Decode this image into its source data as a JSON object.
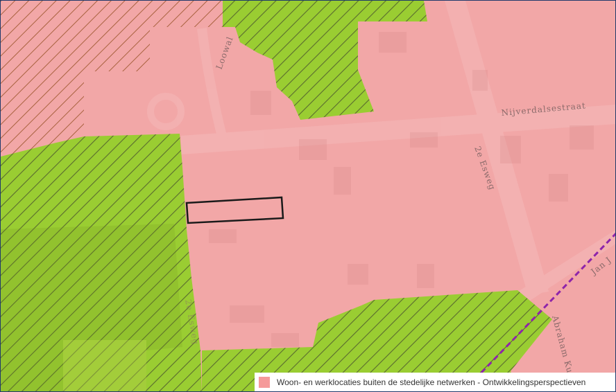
{
  "colors": {
    "zone_fill": "#f2a7a7",
    "green_fill": "#9acd32",
    "hatch_line": "#5a6b2f",
    "boundary": "#1a1a1a",
    "route": "#8e24aa",
    "legend_swatch": "#f59a9a"
  },
  "streets": {
    "nijverdalsestraat": "Nijverdalsestraat",
    "loowal": "Loowal",
    "tweede_esweg": "2e Esweg",
    "jan": "Jan J",
    "abraham_kuyper": "Abraham Kuyp",
    "esweg_left": "2e Esweg"
  },
  "legend": {
    "label": "Woon- en werklocaties buiten de stedelijke netwerken - Ontwikkelingsperspectieven"
  }
}
